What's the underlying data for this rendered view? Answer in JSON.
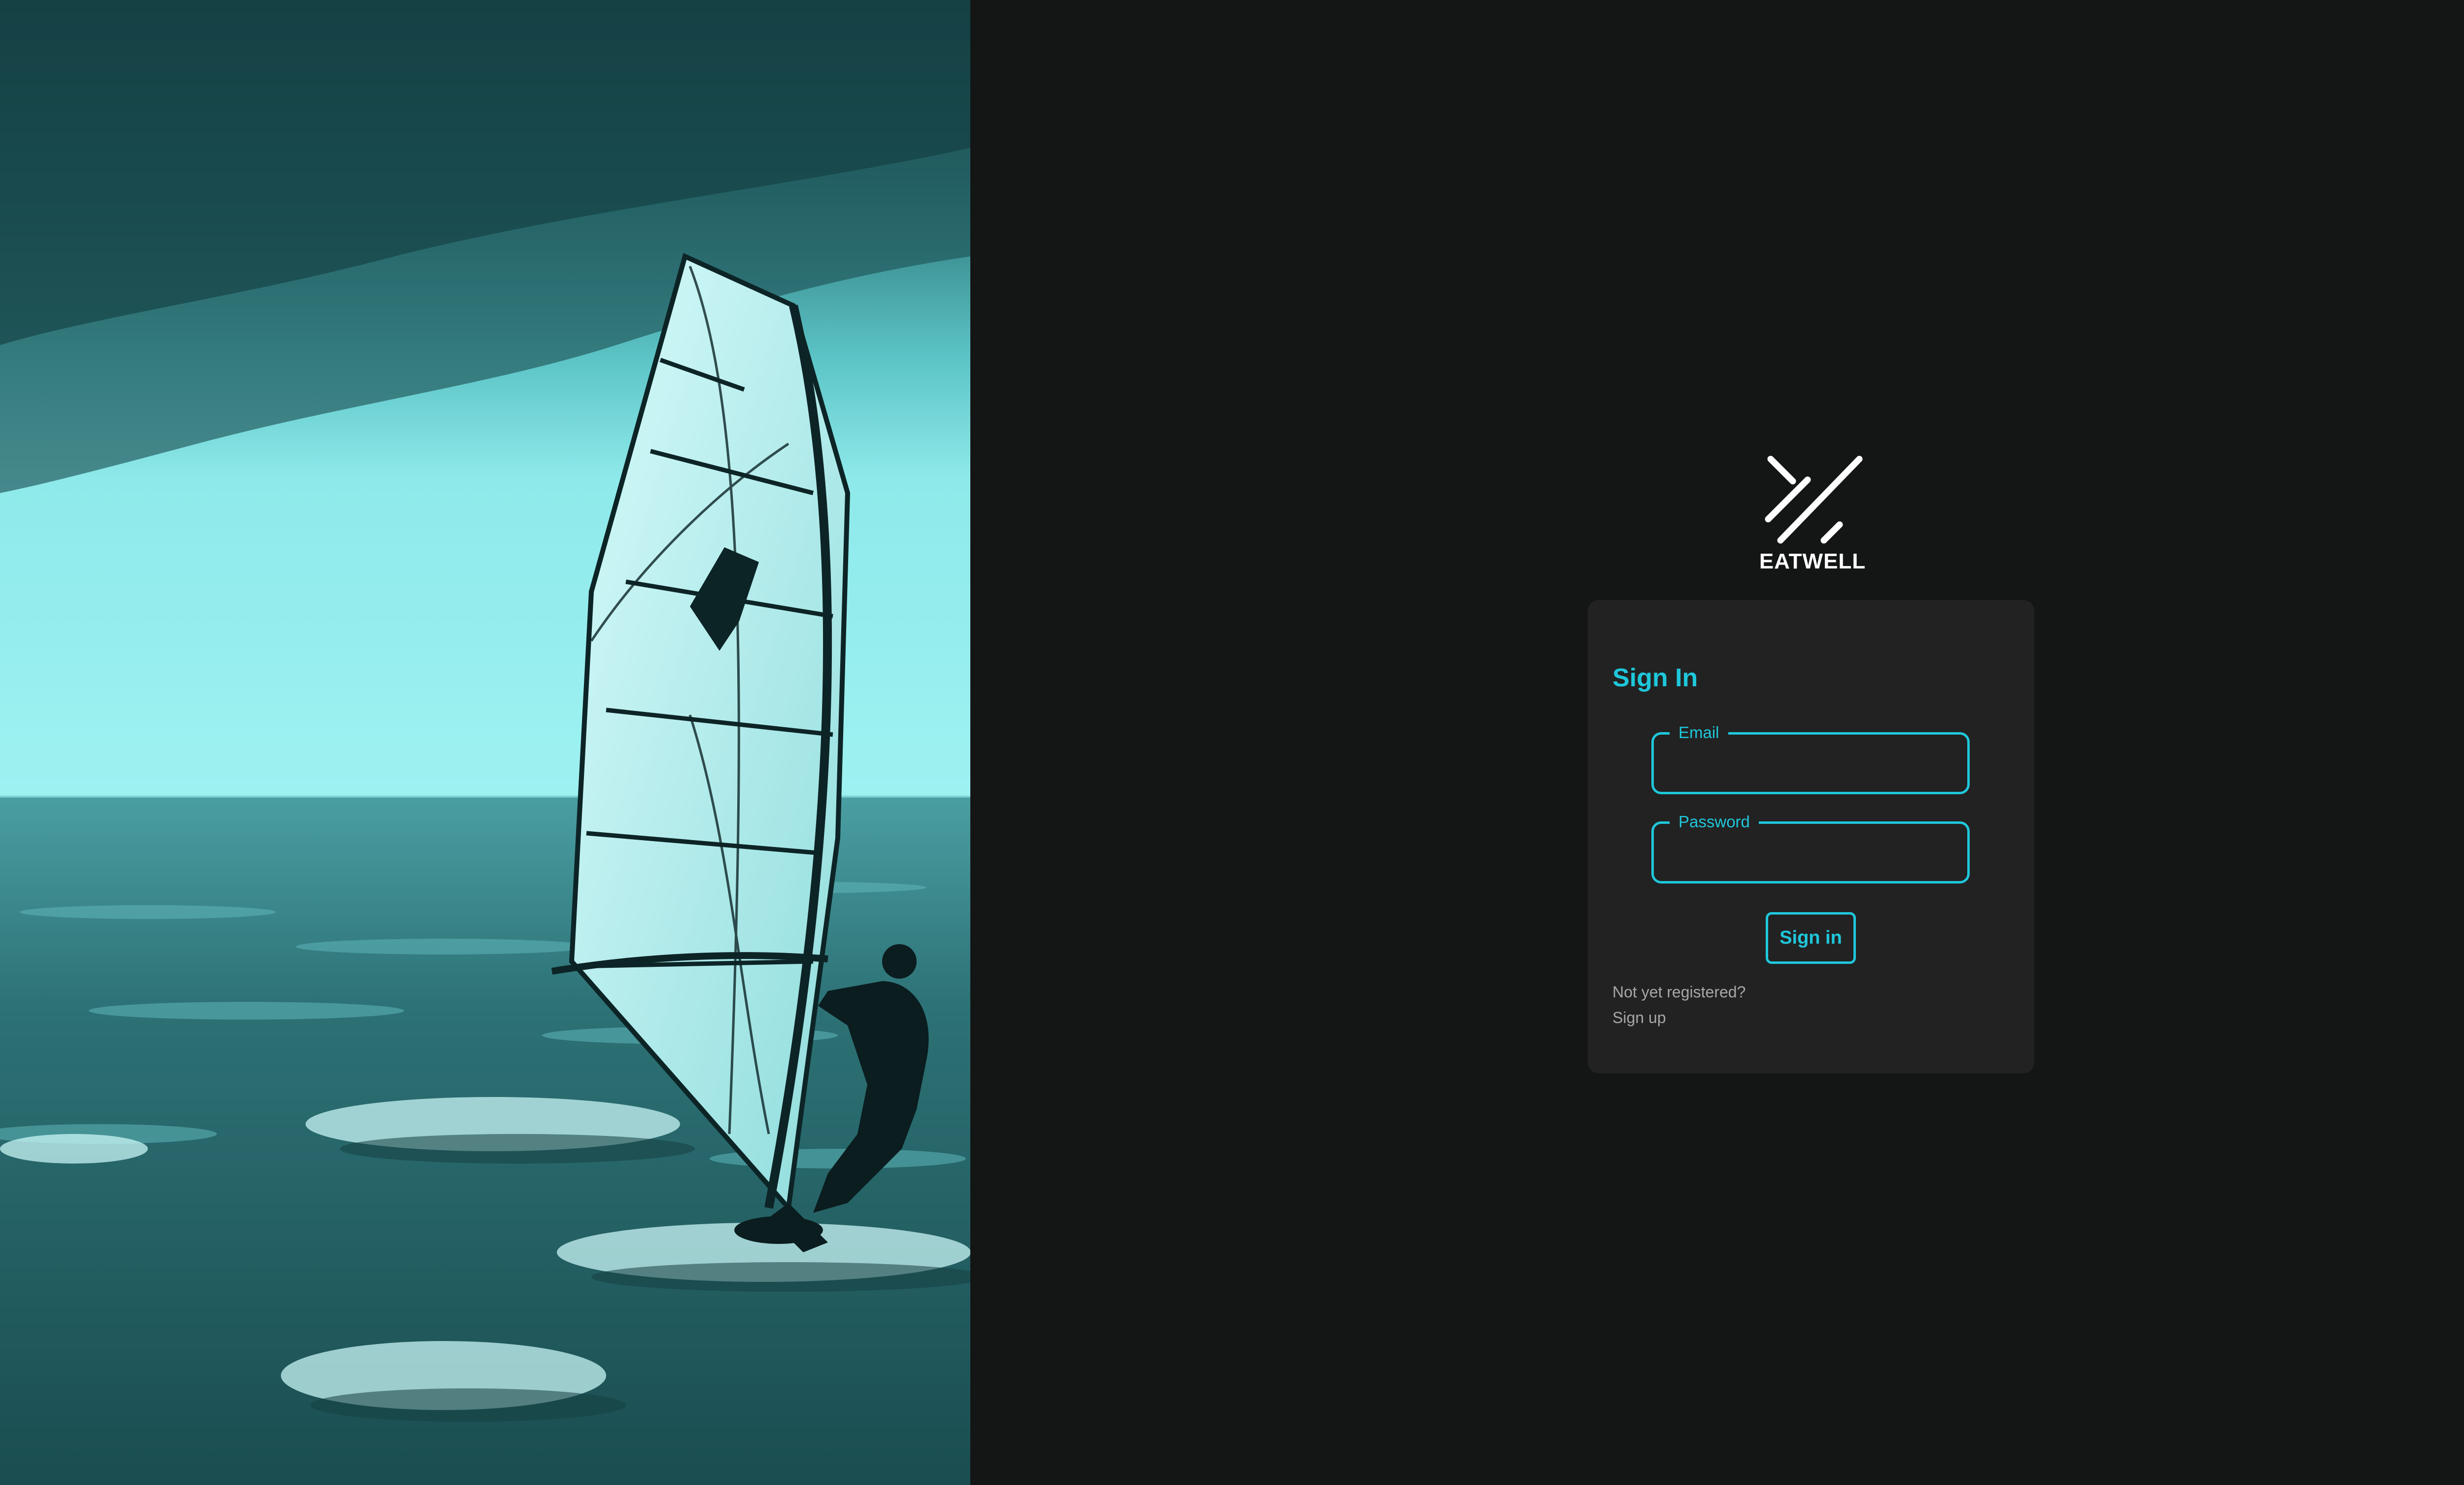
{
  "brand": {
    "name": "EATWELL",
    "logo_icon": "diagonal-stripes-logo-icon"
  },
  "hero": {
    "image": "windsurfer-photo",
    "tint": "#6fe3e3"
  },
  "signin": {
    "title": "Sign In",
    "email_label": "Email",
    "email_value": "",
    "password_label": "Password",
    "password_value": "",
    "submit_label": "Sign in",
    "not_registered_text": "Not yet registered?",
    "signup_label": "Sign up"
  },
  "colors": {
    "accent": "#1fc7db",
    "background": "#141515",
    "card": "#222222",
    "muted_text": "#a7a7a7"
  }
}
